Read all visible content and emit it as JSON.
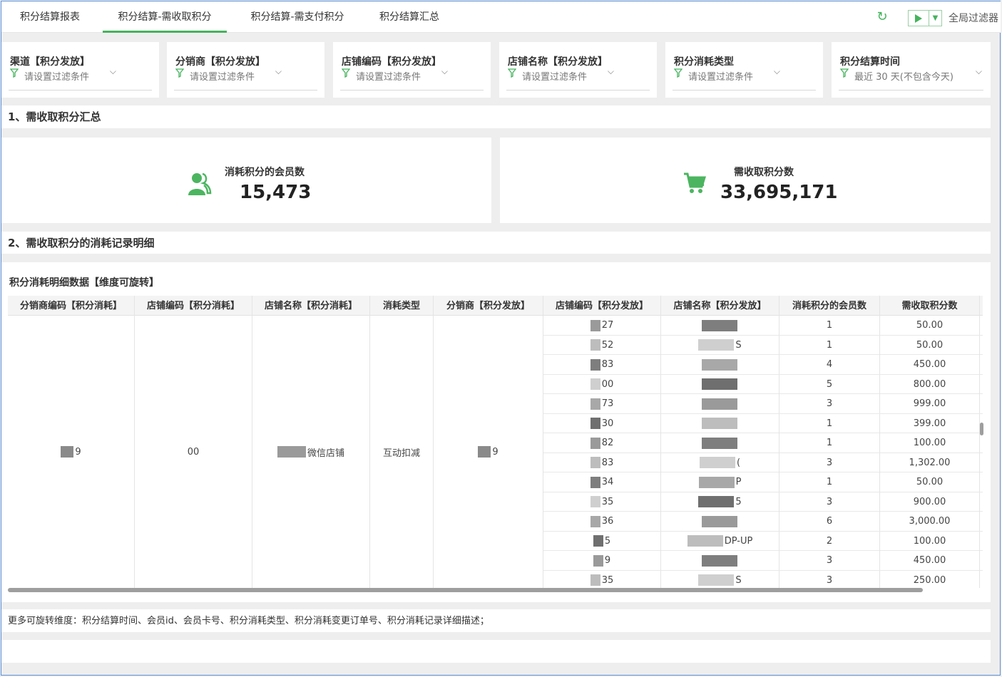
{
  "tabs": [
    {
      "label": "积分结算报表"
    },
    {
      "label": "积分结算-需收取积分"
    },
    {
      "label": "积分结算-需支付积分"
    },
    {
      "label": "积分结算汇总"
    }
  ],
  "toolbar": {
    "global_filter": "全局过滤器"
  },
  "filters": [
    {
      "title": "渠道【积分发放】",
      "placeholder": "请设置过滤条件"
    },
    {
      "title": "分销商【积分发放】",
      "placeholder": "请设置过滤条件"
    },
    {
      "title": "店铺编码【积分发放】",
      "placeholder": "请设置过滤条件"
    },
    {
      "title": "店铺名称【积分发放】",
      "placeholder": "请设置过滤条件"
    },
    {
      "title": "积分消耗类型",
      "placeholder": "请设置过滤条件"
    },
    {
      "title": "积分结算时间",
      "placeholder": "最近 30 天(不包含今天)"
    }
  ],
  "sections": {
    "summary": "1、需收取积分汇总",
    "detail": "2、需收取积分的消耗记录明细"
  },
  "kpis": [
    {
      "label": "消耗积分的会员数",
      "value": "15,473"
    },
    {
      "label": "需收取积分数",
      "value": "33,695,171"
    }
  ],
  "table": {
    "title": "积分消耗明细数据【维度可旋转】",
    "headers": [
      "分销商编码【积分消耗】",
      "店铺编码【积分消耗】",
      "店铺名称【积分消耗】",
      "消耗类型",
      "分销商【积分发放】",
      "店铺编码【积分发放】",
      "店铺名称【积分发放】",
      "消耗积分的会员数",
      "需收取积分数"
    ],
    "merged": [
      "9",
      "00",
      "微信店铺",
      "互动扣减",
      "9"
    ],
    "rows": [
      {
        "code": "27",
        "name": "",
        "members": "1",
        "points": "50.00"
      },
      {
        "code": "52",
        "name": "S",
        "members": "1",
        "points": "50.00"
      },
      {
        "code": "83",
        "name": "",
        "members": "4",
        "points": "450.00"
      },
      {
        "code": "00",
        "name": "",
        "members": "5",
        "points": "800.00"
      },
      {
        "code": "73",
        "name": "",
        "members": "3",
        "points": "999.00"
      },
      {
        "code": "30",
        "name": "",
        "members": "1",
        "points": "399.00"
      },
      {
        "code": "82",
        "name": "",
        "members": "1",
        "points": "100.00"
      },
      {
        "code": "83",
        "name": "(",
        "members": "3",
        "points": "1,302.00"
      },
      {
        "code": "34",
        "name": "P",
        "members": "1",
        "points": "50.00"
      },
      {
        "code": "35",
        "name": "5",
        "members": "3",
        "points": "900.00"
      },
      {
        "code": "36",
        "name": "",
        "members": "6",
        "points": "3,000.00"
      },
      {
        "code": "5",
        "name": "DP-UP",
        "members": "2",
        "points": "100.00"
      },
      {
        "code": "9",
        "name": "",
        "members": "3",
        "points": "450.00"
      },
      {
        "code": "35",
        "name": "S",
        "members": "3",
        "points": "250.00"
      }
    ]
  },
  "note": "更多可旋转维度：积分结算时间、会员id、会员卡号、积分消耗类型、积分消耗变更订单号、积分消耗记录详细描述；"
}
